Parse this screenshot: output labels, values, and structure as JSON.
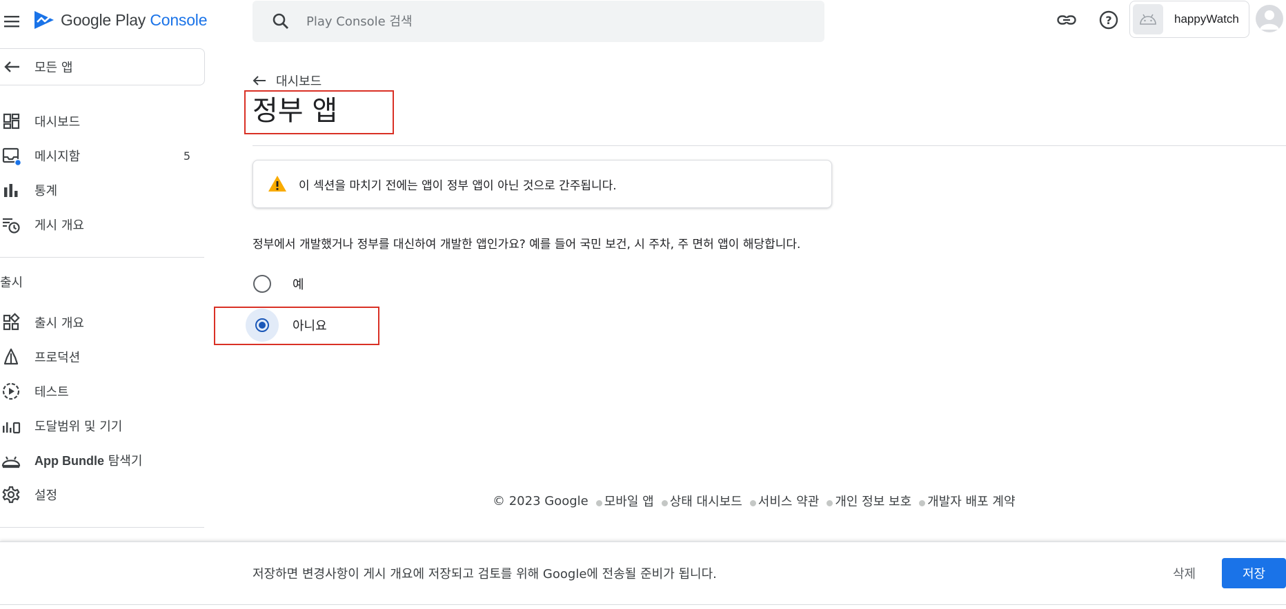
{
  "header": {
    "logo_google_play": "Google Play",
    "logo_console": "Console",
    "search_placeholder": "Play Console 검색",
    "app_name": "happyWatch"
  },
  "sidebar": {
    "all_apps": "모든 앱",
    "items": [
      {
        "label": "대시보드",
        "icon": "dashboard-icon"
      },
      {
        "label": "메시지함",
        "icon": "inbox-icon",
        "count": "5"
      },
      {
        "label": "통계",
        "icon": "bar-chart-icon"
      },
      {
        "label": "게시 개요",
        "icon": "publishing-overview-icon"
      }
    ],
    "section_release": "출시",
    "release_items": [
      {
        "label": "출시 개요",
        "icon": "release-overview-icon"
      },
      {
        "label": "프로덕션",
        "icon": "production-icon"
      },
      {
        "label": "테스트",
        "icon": "testing-icon"
      },
      {
        "label": "도달범위 및 기기",
        "icon": "reach-devices-icon"
      },
      {
        "label_app_bundle": "App Bundle",
        "label_explorer": " 탐색기",
        "icon": "app-bundle-icon"
      },
      {
        "label": "설정",
        "icon": "settings-icon"
      }
    ]
  },
  "main": {
    "back_link": "대시보드",
    "title": "정부 앱",
    "warning": "이 섹션을 마치기 전에는 앱이 정부 앱이 아닌 것으로 간주됩니다.",
    "question": "정부에서 개발했거나 정부를 대신하여 개발한 앱인가요? 예를 들어 국민 보건, 시 주차, 주 면허 앱이 해당합니다.",
    "options": [
      {
        "label": "예",
        "selected": false
      },
      {
        "label": "아니요",
        "selected": true
      }
    ]
  },
  "footer": {
    "copyright": "© 2023 Google",
    "links": [
      "모바일 앱",
      "상태 대시보드",
      "서비스 약관",
      "개인 정보 보호",
      "개발자 배포 계약"
    ]
  },
  "bottom_bar": {
    "message": "저장하면 변경사항이 게시 개요에 저장되고 검토를 위해 Google에 전송될 준비가 됩니다.",
    "delete": "삭제",
    "save": "저장"
  },
  "colors": {
    "accent": "#1a73e8",
    "radio_selected": "#1a57b8",
    "warning": "#f9ab00",
    "highlight_box": "#d93025"
  }
}
